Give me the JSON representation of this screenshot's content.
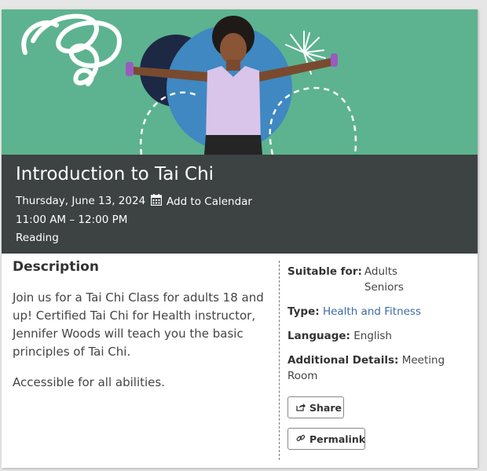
{
  "event": {
    "title": "Introduction to Tai Chi",
    "date": "Thursday, June 13, 2024",
    "add_to_calendar": "Add to Calendar",
    "time": "11:00 AM – 12:00 PM",
    "branch": "Reading"
  },
  "description": {
    "heading": "Description",
    "paragraphs": [
      "Join us for a Tai Chi Class for adults 18 and up! Certified Tai Chi for Health instructor, Jennifer Woods will teach you the basic principles of Tai Chi.",
      "Accessible for all abilities."
    ]
  },
  "details": {
    "suitable_label": "Suitable for:",
    "suitable_values": [
      "Adults",
      "Seniors"
    ],
    "type_label": "Type:",
    "type_value": "Health and Fitness",
    "language_label": "Language:",
    "language_value": "English",
    "additional_label": "Additional Details:",
    "additional_value": "Meeting Room"
  },
  "buttons": {
    "share": "Share",
    "permalink": "Permalink"
  },
  "colors": {
    "hero_green": "#5db38f",
    "header_dark": "#3d4242",
    "link_blue": "#3d6aa6"
  },
  "icons": {
    "calendar": "calendar-icon",
    "share": "share-icon",
    "link": "link-icon"
  }
}
